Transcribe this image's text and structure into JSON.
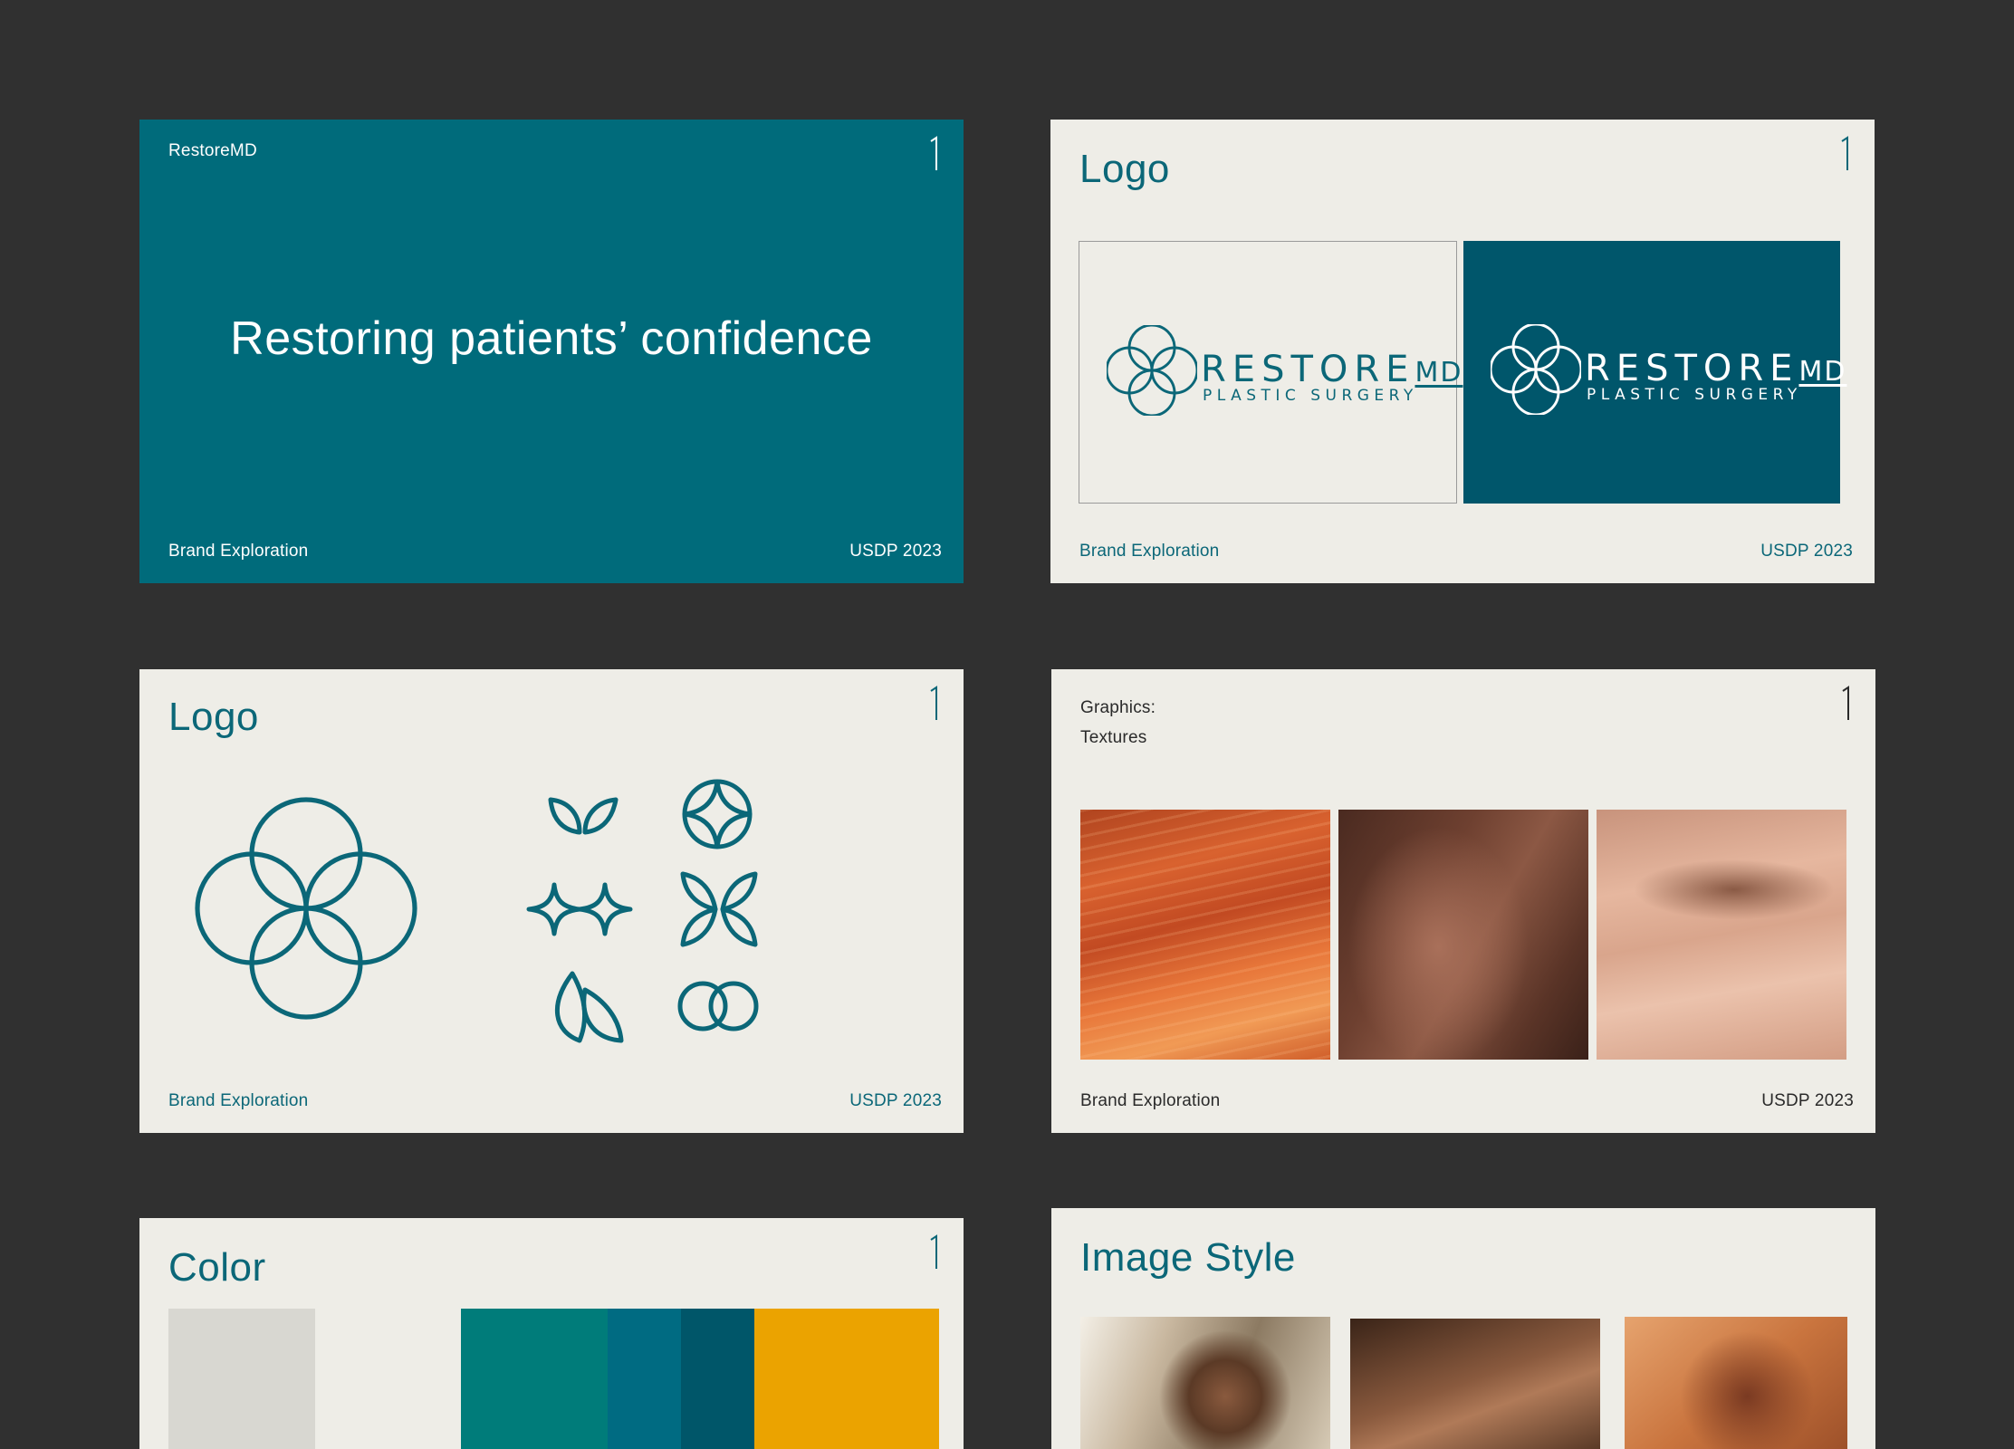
{
  "slides": {
    "cover": {
      "brand": "RestoreMD",
      "headline": "Restoring patients’ confidence",
      "footer_left": "Brand Exploration",
      "footer_right": "USDP 2023"
    },
    "logo_lockup": {
      "title": "Logo",
      "wordmark_main": "RESTORE",
      "wordmark_md": "MD",
      "wordmark_sub": "PLASTIC SURGERY",
      "footer_left": "Brand Exploration",
      "footer_right": "USDP 2023"
    },
    "logo_marks": {
      "title": "Logo",
      "footer_left": "Brand Exploration",
      "footer_right": "USDP 2023"
    },
    "textures": {
      "label_line1": "Graphics:",
      "label_line2": "Textures",
      "footer_left": "Brand Exploration",
      "footer_right": "USDP 2023"
    },
    "color": {
      "title": "Color",
      "swatches": [
        "#D8D7D1",
        "#007C7A",
        "#006B82",
        "#005669",
        "#EBA300"
      ]
    },
    "image_style": {
      "title": "Image Style"
    }
  },
  "colors": {
    "background": "#303030",
    "slide_light": "#EEEDE7",
    "teal_primary": "#006B7B",
    "teal_text": "#0B6778",
    "logo_panel_dark": "#00566B"
  }
}
